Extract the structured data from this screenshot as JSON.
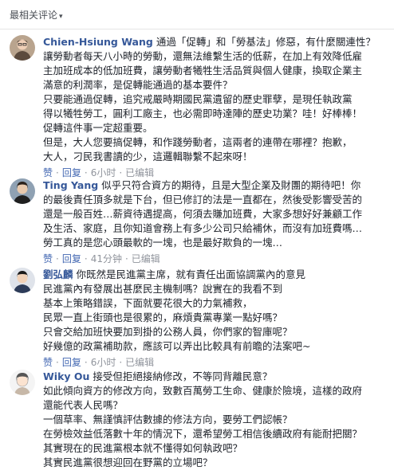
{
  "header": {
    "sort_label": "最相关评论",
    "caret": "▾"
  },
  "comments": [
    {
      "author": "Chien-Hsiung Wang",
      "lines": [
        "通過「促轉」和「勞基法」修惡，有什麼關連性？",
        "讓勞動者每天八小時的勞動，還無法維繫生活的低薪，在加上有效降低雇",
        "主加班成本的低加班費，讓勞動者犧牲生活品質與個人健康，換取企業主",
        "滿意的利潤率，是促轉能通過的基本要件？",
        "只要能通過促轉，追究戒嚴時期國民黨遺留的歷史罪孽，是現任執政黨",
        "得以犧牲勞工，圓利工廠主，也必需即時達陣的歷史功業？哇！好棒棒！",
        "促轉這件事一定超重要。",
        "但是，大人您要搞促轉，和作踐勞動者，這兩者的連帶在哪裡？抱歉，",
        "大人，刁民我書讀的少，這邏輯聯繫不起來呀！"
      ],
      "actions": {
        "like": "赞",
        "reply": "回复",
        "time": "6小时",
        "edited": "已编辑"
      }
    },
    {
      "author": "Ting Yang",
      "lines": [
        "似乎只符合資方的期待，且是大型企業及財團的期待吧！你",
        "的最後責任頂多就是下台，但已修訂的法是一直都在，然後受影響受苦的",
        "還是一般百姓…薪資待遇提高，何須去賺加班費，大家多想好好兼顧工作",
        "及生活、家庭，且你知道會務上有多少公司只給補休，而沒有加班費嗎…",
        "勞工真的是您心頭最軟的一塊，也是最好欺負的一塊…"
      ],
      "actions": {
        "like": "赞",
        "reply": "回复",
        "time": "41分钟",
        "edited": "已编辑"
      }
    },
    {
      "author": "劉弘麟",
      "lines": [
        "你既然是民進黨主席，就有責任出面協調黨內的意見",
        "民進黨內有發展出甚麼民主機制嗎？說實在的我看不到",
        "基本上策略錯誤，下面就要花很大的力氣補救，",
        "民眾一直上街頭也是很累的，麻煩貴黨專業一點好嗎？",
        "只會交給加班快要加到掛的公務人員，你們家的智庫呢？",
        "好幾億的政黨補助款，應該可以弄出比較具有前瞻的法案吧~"
      ],
      "actions": {
        "like": "赞",
        "reply": "回复",
        "time": "6小时",
        "edited": "已编辑"
      }
    },
    {
      "author": "Wiky Ou",
      "lines": [
        "接受但拒絕接納修改，不等同背離民意？",
        "如此傾向資方的修改方向，致數百萬勞工生命、健康於險境，這樣的政府",
        "還能代表人民嗎？",
        "一個草率、無謹慎評估數據的修法方向，要勞工們認帳？",
        "在勞檢效益低落數十年的情況下，還希望勞工相信後續政府有能耐把關？",
        "其實現在的民進黨根本就不懂得如何執政吧？",
        "其實民進黨很想迎回在野黨的立場吧？"
      ]
    }
  ]
}
